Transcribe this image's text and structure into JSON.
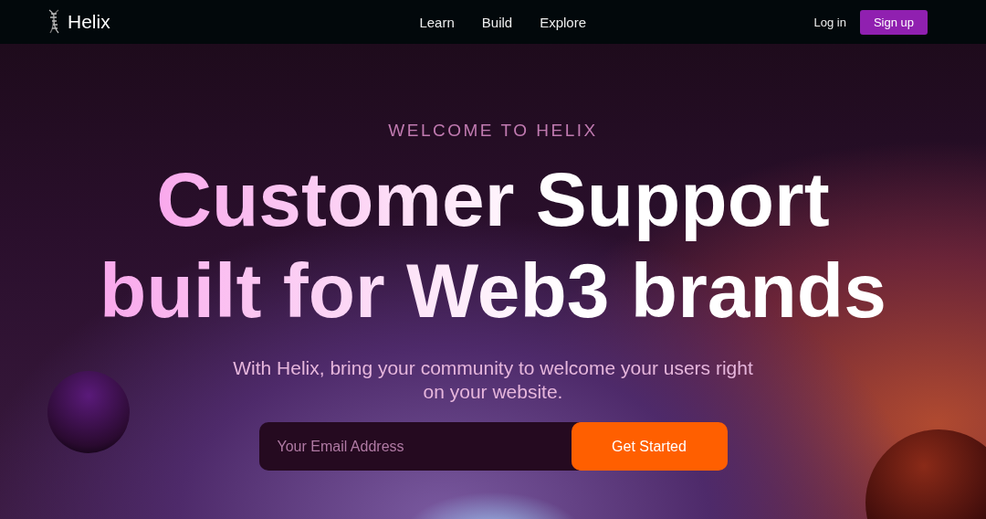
{
  "brand": {
    "name": "Helix"
  },
  "nav": [
    {
      "label": "Learn"
    },
    {
      "label": "Build"
    },
    {
      "label": "Explore"
    }
  ],
  "auth": {
    "login": "Log in",
    "signup": "Sign up"
  },
  "hero": {
    "eyebrow": "WELCOME TO HELIX",
    "headline": [
      "Customer Support",
      "built for Web3 brands"
    ],
    "subtitle": "With Helix, bring your community to welcome your users right on your website.",
    "email": {
      "placeholder": "Your Email Address"
    },
    "cta": "Get Started"
  }
}
